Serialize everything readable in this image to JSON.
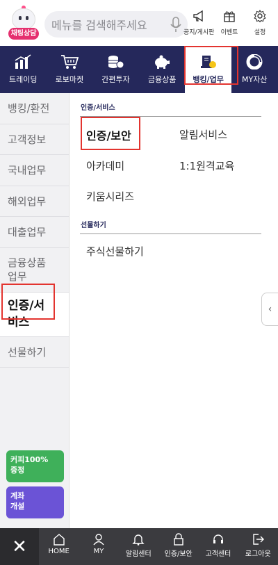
{
  "header": {
    "chatbot_label": "채팅상담",
    "search_placeholder": "메뉴를 검색해주세요",
    "icons": [
      {
        "label": "공지/게시판",
        "icon": "megaphone-icon"
      },
      {
        "label": "이벤트",
        "icon": "gift-icon"
      },
      {
        "label": "설정",
        "icon": "gear-icon"
      }
    ]
  },
  "nav": {
    "items": [
      {
        "label": "트레이딩",
        "icon": "chart-icon"
      },
      {
        "label": "로보마켓",
        "icon": "cart-icon"
      },
      {
        "label": "간편투자",
        "icon": "coins-icon"
      },
      {
        "label": "금융상품",
        "icon": "piggy-bank-icon"
      },
      {
        "label": "뱅킹/업무",
        "icon": "banking-icon"
      },
      {
        "label": "MY자산",
        "icon": "donut-chart-icon"
      }
    ],
    "active_index": 4
  },
  "sidebar": {
    "items": [
      {
        "label": "뱅킹/환전"
      },
      {
        "label": "고객정보"
      },
      {
        "label": "국내업무"
      },
      {
        "label": "해외업무"
      },
      {
        "label": "대출업무"
      },
      {
        "label": "금융상품\n업무"
      },
      {
        "label": "인증/서\n비스"
      },
      {
        "label": "선물하기"
      }
    ],
    "active_index": 6,
    "promos": [
      {
        "label": "커피100%\n증정"
      },
      {
        "label": "계좌\n개설"
      }
    ]
  },
  "main": {
    "sections": [
      {
        "title": "인증/서비스",
        "links": [
          "인증/보안",
          "알림서비스",
          "아카데미",
          "1:1원격교육",
          "키움시리즈"
        ]
      },
      {
        "title": "선물하기",
        "links": [
          "주식선물하기"
        ]
      }
    ]
  },
  "bottombar": {
    "items": [
      {
        "label": "HOME",
        "icon": "home-icon"
      },
      {
        "label": "MY",
        "icon": "user-icon"
      },
      {
        "label": "알림센터",
        "icon": "bell-icon"
      },
      {
        "label": "인증/보안",
        "icon": "lock-icon"
      },
      {
        "label": "고객센터",
        "icon": "headset-icon"
      },
      {
        "label": "로그아웃",
        "icon": "logout-icon"
      }
    ]
  },
  "colors": {
    "nav_bg": "#25285b",
    "highlight": "#e3342f",
    "bottom_bg": "#3b3b3f"
  }
}
